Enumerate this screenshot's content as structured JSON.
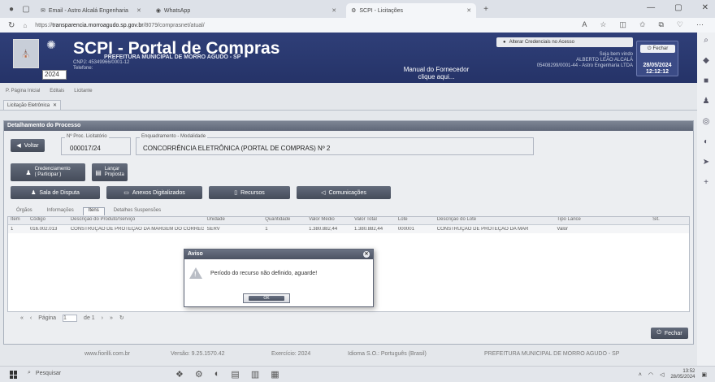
{
  "browser": {
    "tabs": [
      {
        "label": "Email - Astro Alcalá Engenharia",
        "active": false
      },
      {
        "label": "WhatsApp",
        "active": false
      },
      {
        "label": "SCPI - Licitações",
        "active": true
      }
    ],
    "url_host": "transparencia.morroagudo.sp.gov.br",
    "url_rest": "/8079/comprasnet/atual/",
    "url_prefix": "https://"
  },
  "header": {
    "title": "SCPI - Portal de Compras",
    "subtitle": "PREFEITURA MUNICIPAL DE MORRO AGUDO - SP",
    "cnpj": "CNPJ: 45349966/0001-12",
    "phone": "Telefone:",
    "year": "2024",
    "manual_line1": "Manual do Fornecedor",
    "manual_line2": "clique aqui...",
    "alterar_label": "Alterar Credenciais no Acesso",
    "user_line1": "Seja bem vindo",
    "user_line2": "ALBERTO LEÃO ALCALÁ",
    "user_line3": "05408299/0001-44 - Astro Engenharia LTDA",
    "fechar_label": "Fechar",
    "date": "28/05/2024",
    "time": "12:12:12"
  },
  "toolbar": {
    "items": [
      "P. Página Inicial",
      "Editais",
      "Licitante"
    ]
  },
  "pagetab": {
    "label": "Licitação Eletrônica"
  },
  "panel": {
    "title": "Detalhamento do Processo",
    "voltar": "Voltar",
    "proc_legend": "Nº Proc. Licitatório",
    "proc_value": "000017/24",
    "enq_legend": "Enquadramento - Modalidade",
    "enq_value": "CONCORRÊNCIA ELETRÔNICA (PORTAL DE COMPRAS) Nº 2",
    "credenciamento": "Credenciamento",
    "participar": "( Participar )",
    "lancar": "Lançar",
    "proposta": "Proposta",
    "sala_disputa": "Sala de Disputa",
    "anexos": "Anexos Digitalizados",
    "recursos": "Recursos",
    "comunicacoes": "Comunicações",
    "subtabs": [
      "Órgãos",
      "Informações",
      "Itens",
      "Detalhes Suspensões"
    ],
    "columns": [
      "Item",
      "Código",
      "Descrição do Produto/Serviço",
      "Unidade",
      "Quantidade",
      "Valor Médio",
      "Valor Total",
      "Lote",
      "Descrição do Lote",
      "Tipo Lance",
      "Sit."
    ],
    "row": [
      "1",
      "016.002.013",
      "CONSTRUÇÃO DE PROTEÇÃO DA MARGEM DO CORREGO P",
      "SERV",
      "1",
      "1.380.882,44",
      "1.380.882,44",
      "000001",
      "CONSTRUÇÃO DE PROTEÇÃO DA MAR",
      "Valor",
      ""
    ],
    "pager_label": "Página",
    "pager_page": "1",
    "pager_of": "de 1",
    "fechar": "Fechar"
  },
  "statusbar": {
    "site": "www.fiorilli.com.br",
    "version": "Versão: 9.25.1570.42",
    "exercicio": "Exercício: 2024",
    "idioma": "Idioma S.O.: Português (Brasil)",
    "prefeitura": "PREFEITURA MUNICIPAL DE MORRO AGUDO - SP"
  },
  "modal": {
    "title": "Aviso",
    "message": "Período do recurso não definido, aguarde!",
    "ok": "OK"
  },
  "taskbar": {
    "search": "Pesquisar",
    "time": "13:52",
    "date": "28/05/2024"
  }
}
